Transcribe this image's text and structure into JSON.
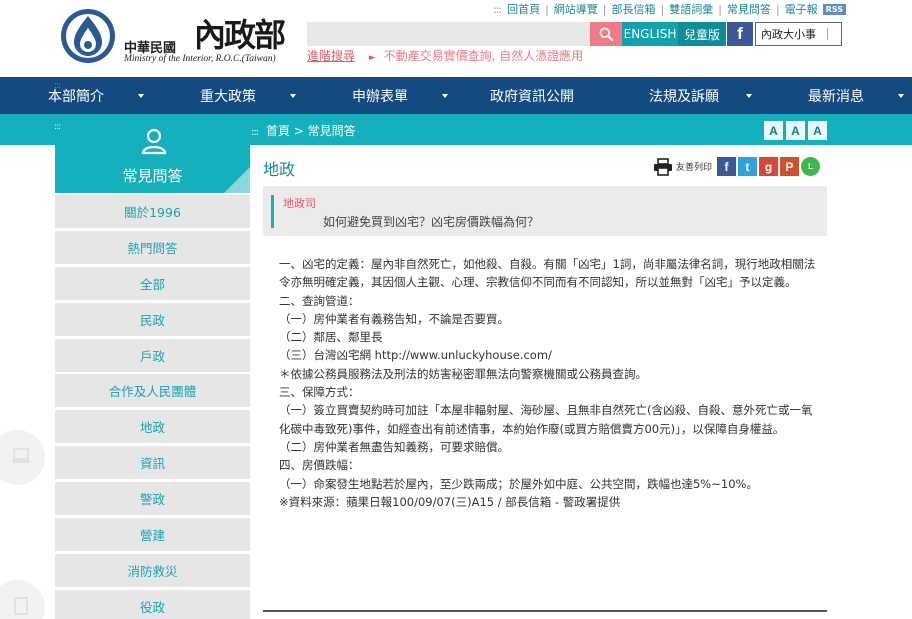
{
  "header": {
    "logo_cn": "中華民國",
    "logo_big": "內政部",
    "logo_en": "Ministry of the Interior, R.O.C.(Taiwan)",
    "top_links": [
      "回首頁",
      "網站導覽",
      "部長信箱",
      "雙語詞彙",
      "常見問答",
      "電子報"
    ],
    "rss_label": "RSS",
    "english_label": "ENGLISH",
    "kids_label": "兒童版",
    "dictionary_value": "內政大小事",
    "advanced_search_label": "進階搜尋",
    "hot_search_text": "不動產交易實價查詢, 自然人憑證應用"
  },
  "nav": {
    "items": [
      "本部簡介",
      "重大政策",
      "申辦表單",
      "政府資訊公開",
      "法規及訴願",
      "最新消息"
    ]
  },
  "breadcrumb": {
    "home": "首頁",
    "separator": ">",
    "current": "常見問答"
  },
  "font_sizes": [
    "A",
    "A",
    "A"
  ],
  "sidebar": {
    "title": "常見問答",
    "items": [
      "關於1996",
      "熱門問答",
      "全部",
      "民政",
      "戶政",
      "合作及人民團體",
      "地政",
      "資訊",
      "警政",
      "營建",
      "消防救災",
      "役政"
    ]
  },
  "content": {
    "title": "地政",
    "print_label": "友善列印",
    "social": [
      {
        "name": "facebook",
        "glyph": "f",
        "color": "#3b5998"
      },
      {
        "name": "twitter",
        "glyph": "t",
        "color": "#2fa3d9"
      },
      {
        "name": "google-plus",
        "glyph": "g",
        "color": "#d9453b"
      },
      {
        "name": "plurk",
        "glyph": "P",
        "color": "#d2502e"
      },
      {
        "name": "line",
        "glyph": "L",
        "color": "#3fb84b"
      }
    ],
    "question_dept": "地政司",
    "question": "如何避免買到凶宅？凶宅房價跌幅為何？",
    "answer_lines": [
      "一、凶宅的定義：屋內非自然死亡，如他殺、自殺。有關「凶宅」1詞，尚非屬法律名詞，現行地政相關法令亦無明確定義，其因個人主觀、心理、宗教信仰不同而有不同認知，所以並無對「凶宅」予以定義。",
      "二、查詢管道：",
      "（一）房仲業者有義務告知，不論是否要買。",
      "（二）鄰居、鄰里長",
      "（三）台灣凶宅網 http://www.unluckyhouse.com/",
      "＊依據公務員服務法及刑法的妨害秘密罪無法向警察機關或公務員查詢。",
      "三、保障方式：",
      "（一）簽立買賣契約時可加註「本屋非輻射屋、海砂屋、且無非自然死亡(含凶殺、自殺、意外死亡或一氧化碳中毒致死)事件，如經查出有前述情事，本約始作廢(或買方賠償賣方00元)」，以保障自身權益。",
      "（二）房仲業者無盡告知義務，可要求賠償。",
      "四、房價跌幅：",
      "（一）命案發生地點若於屋內，至少跌兩成；於屋外如中庭、公共空間，跌幅也達5%~10%。",
      "※資料來源：蘋果日報100/09/07(三)A15 / 部長信箱 - 警政署提供"
    ]
  },
  "colors": {
    "nav_blue": "#144a82",
    "teal": "#15b0bd",
    "pink": "#f07a86",
    "link_teal": "#15a5b2",
    "dept_red": "#e05a66"
  }
}
